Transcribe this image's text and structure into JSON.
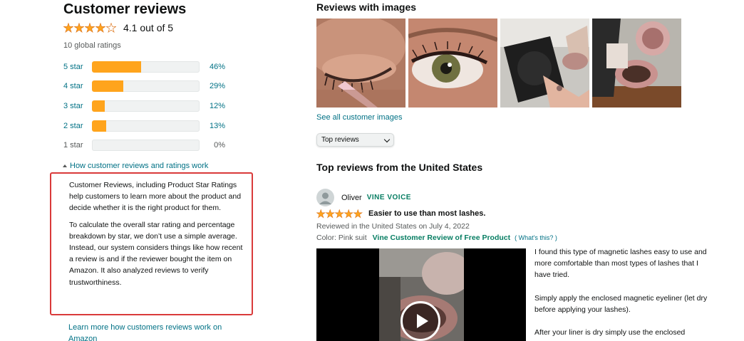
{
  "ratings": {
    "heading": "Customer reviews",
    "average_text": "4.1 out of 5",
    "average_value": 4.1,
    "global_ratings": "10 global ratings",
    "star_color": "#ffa41c",
    "histogram": [
      {
        "label": "5 star",
        "percent_text": "46%",
        "percent": 46
      },
      {
        "label": "4 star",
        "percent_text": "29%",
        "percent": 29
      },
      {
        "label": "3 star",
        "percent_text": "12%",
        "percent": 12
      },
      {
        "label": "2 star",
        "percent_text": "13%",
        "percent": 13
      },
      {
        "label": "1 star",
        "percent_text": "0%",
        "percent": 0
      }
    ],
    "how_link": "How customer reviews and ratings work",
    "explanation": [
      "Customer Reviews, including Product Star Ratings help customers to learn more about the product and decide whether it is the right product for them.",
      "To calculate the overall star rating and percentage breakdown by star, we don’t use a simple average. Instead, our system considers things like how recent a review is and if the reviewer bought the item on Amazon. It also analyzed reviews to verify trustworthiness."
    ],
    "learn_more": "Learn more how customers reviews work on Amazon"
  },
  "images_section": {
    "heading": "Reviews with images",
    "see_all": "See all customer images"
  },
  "sort": {
    "selected": "Top reviews"
  },
  "top_reviews": {
    "heading": "Top reviews from the United States",
    "review": {
      "reviewer": "Oliver",
      "badge": "VINE VOICE",
      "rating": 5,
      "title": "Easier to use than most lashes.",
      "date": "Reviewed in the United States on July 4, 2022",
      "color": "Color: Pink suit",
      "vine_label": "Vine Customer Review of Free Product",
      "whats_this": "( What's this? )",
      "body": [
        "I found this type of magnetic lashes easy to use and more comfortable than most types of lashes that I have tried.",
        "Simply apply the enclosed magnetic eyeliner (let dry before applying your lashes).",
        "After your liner is dry simply use the enclosed"
      ]
    }
  }
}
